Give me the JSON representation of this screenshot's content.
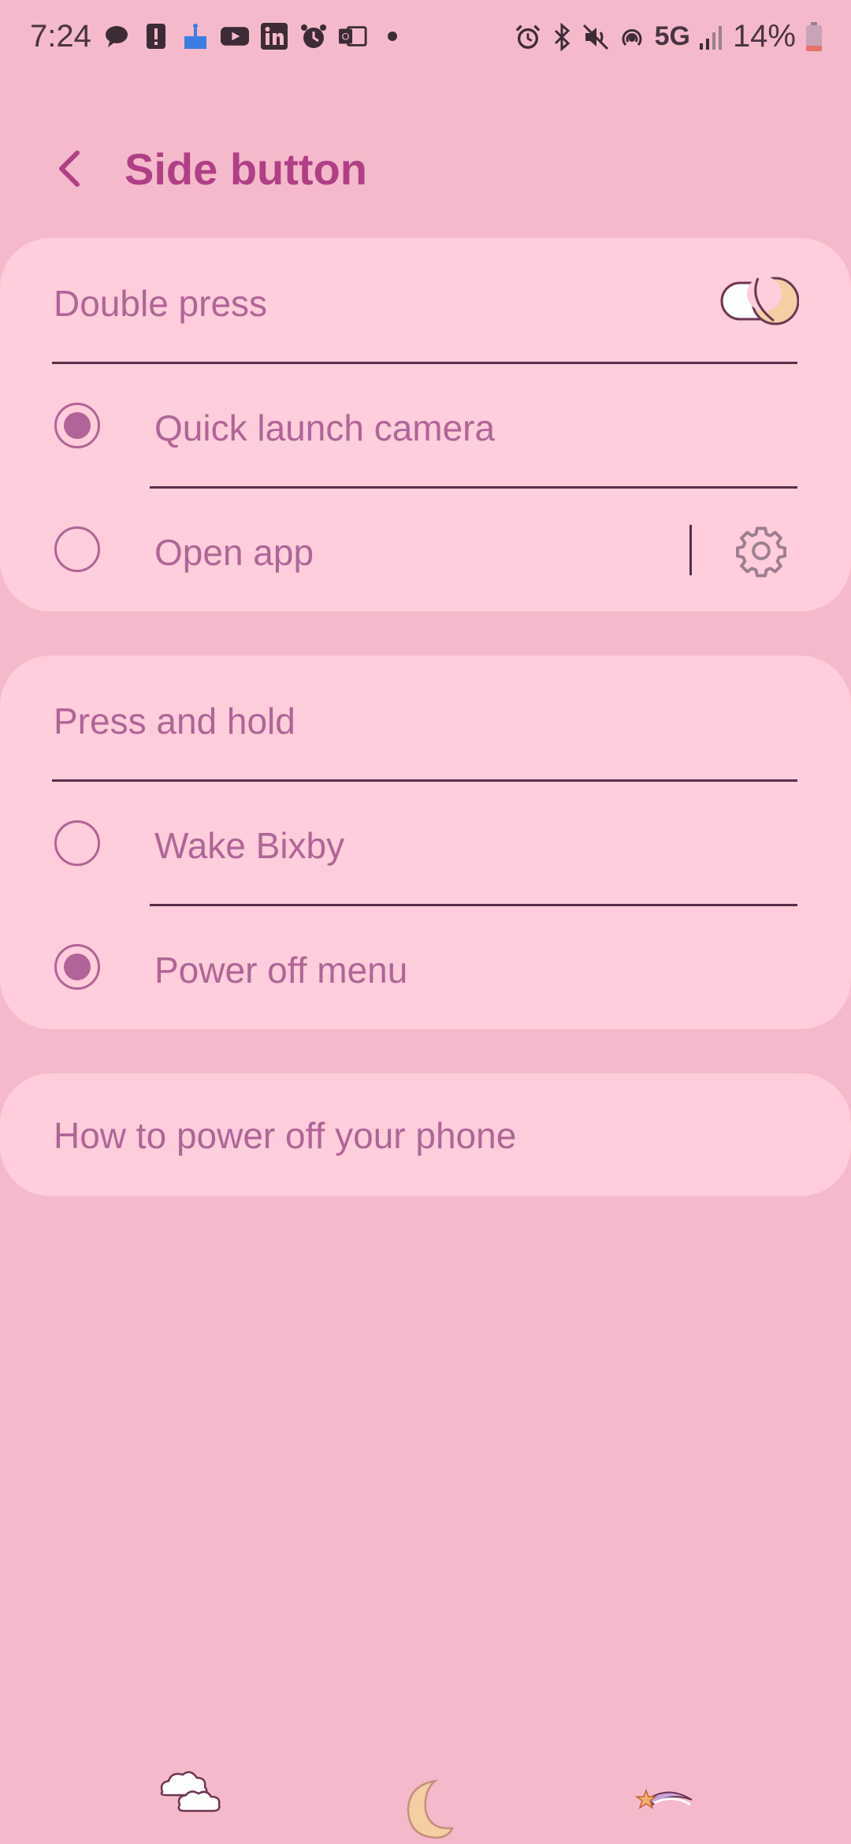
{
  "status_bar": {
    "time": "7:24",
    "network": "5G",
    "battery_percent": "14%"
  },
  "header": {
    "title": "Side button"
  },
  "double_press": {
    "label": "Double press",
    "enabled": true,
    "options": [
      {
        "label": "Quick launch camera",
        "selected": true
      },
      {
        "label": "Open app",
        "selected": false
      }
    ]
  },
  "press_and_hold": {
    "label": "Press and hold",
    "options": [
      {
        "label": "Wake Bixby",
        "selected": false
      },
      {
        "label": "Power off menu",
        "selected": true
      }
    ]
  },
  "help_link": {
    "label": "How to power off your phone"
  },
  "colors": {
    "background": "#f4bacb",
    "card": "#ffcddb",
    "accent": "#b03f86",
    "text": "#b16497",
    "divider": "#5a2e4a"
  },
  "icons": [
    "back-arrow-icon",
    "gear-icon",
    "cloud-icon",
    "moon-icon",
    "shooting-star-icon"
  ]
}
